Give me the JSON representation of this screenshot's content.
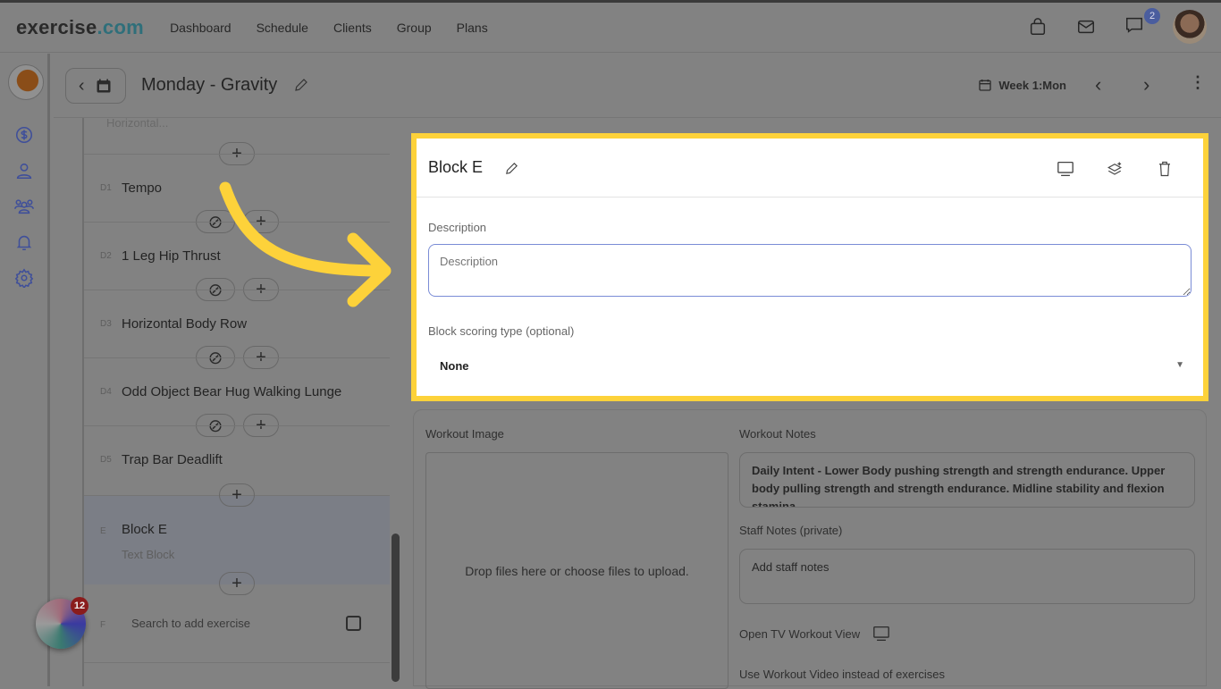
{
  "header": {
    "logo_main": "exercise",
    "logo_accent": ".com",
    "nav": [
      "Dashboard",
      "Schedule",
      "Clients",
      "Group",
      "Plans"
    ],
    "chat_badge": "2"
  },
  "subheader": {
    "title": "Monday - Gravity",
    "week": "Week 1:Mon"
  },
  "list": {
    "prev_subtitle": "Horizontal...",
    "items": [
      {
        "label": "D1",
        "name": "Tempo"
      },
      {
        "label": "D2",
        "name": "1 Leg Hip Thrust"
      },
      {
        "label": "D3",
        "name": "Horizontal Body Row"
      },
      {
        "label": "D4",
        "name": "Odd Object Bear Hug Walking Lunge"
      },
      {
        "label": "D5",
        "name": "Trap Bar Deadlift"
      }
    ],
    "block": {
      "label": "E",
      "name": "Block E",
      "subtitle": "Text Block"
    },
    "search": {
      "label": "F",
      "placeholder": "Search to add exercise"
    },
    "plus": "+",
    "widget_badge": "12"
  },
  "block_panel": {
    "title": "Block E",
    "description_label": "Description",
    "description_placeholder": "Description",
    "scoring_label": "Block scoring type (optional)",
    "scoring_value": "None"
  },
  "workout": {
    "image_label": "Workout Image",
    "drop_text": "Drop files here or choose files to upload.",
    "notes_label": "Workout Notes",
    "notes_value": "Daily Intent - Lower Body pushing strength and strength endurance. Upper body pulling strength and strength endurance. Midline stability and flexion stamina.\nPoints of Performance:",
    "staff_label": "Staff Notes (private)",
    "staff_placeholder": "Add staff notes",
    "tv_label": "Open TV Workout View",
    "video_label": "Use Workout Video instead of exercises"
  },
  "colors": {
    "highlight": "#fdd23a",
    "arrow": "#fdd23a",
    "accent": "#3f4f9a"
  }
}
